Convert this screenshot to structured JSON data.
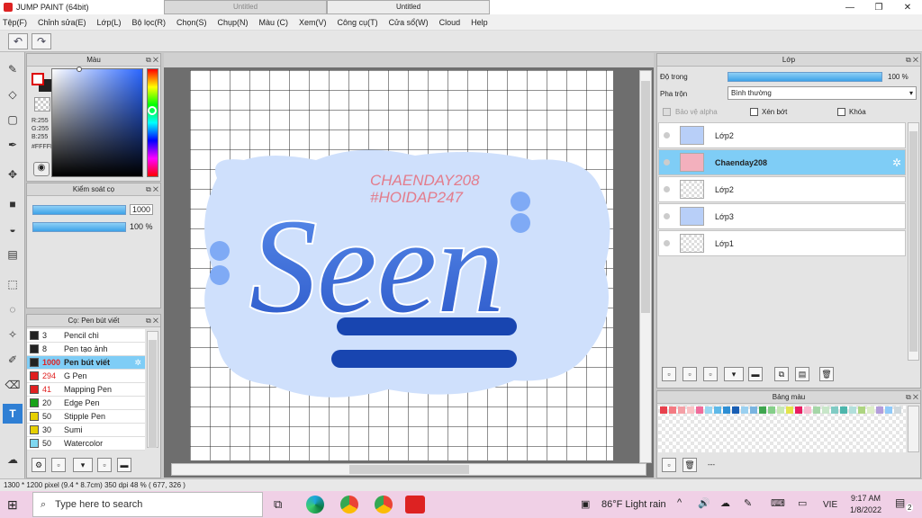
{
  "app": {
    "title": "JUMP PAINT (64bit)",
    "window_controls": [
      "—",
      "❐",
      "✕"
    ]
  },
  "menu": [
    "Tệp(F)",
    "Chỉnh sửa(E)",
    "Lớp(L)",
    "Bộ lọc(R)",
    "Chọn(S)",
    "Chụp(N)",
    "Màu (C)",
    "Xem(V)",
    "Công cụ(T)",
    "Cửa sổ(W)",
    "Cloud",
    "Help"
  ],
  "toolbar": {
    "undo": "↶",
    "redo": "↷"
  },
  "tools": [
    "brush-icon",
    "eraser-icon",
    "select-rect-icon",
    "pen-tool-icon",
    "move-icon",
    "fill-rect-icon",
    "bucket-icon",
    "gradient-icon",
    "lasso-icon",
    "ellipse-select-icon",
    "magic-wand-icon",
    "select-pen-icon",
    "select-eraser-icon",
    "text-tool-icon",
    "hand-icon"
  ],
  "color_panel": {
    "title": "Màu",
    "r": "R:255",
    "g": "G:255",
    "b": "B:255",
    "hex": "#FFFFFF"
  },
  "brush_panel": {
    "title": "Kiểm soát cọ",
    "size": "1000",
    "opacity": "100 %"
  },
  "pen_panel": {
    "title": "Cọ: Pen bút viết",
    "items": [
      {
        "num": "3",
        "name": "Pencil chì",
        "color": "#222222"
      },
      {
        "num": "8",
        "name": "Pen tạo ảnh",
        "color": "#222222"
      },
      {
        "num": "1000",
        "name": "Pen bút viết",
        "color": "#222222"
      },
      {
        "num": "294",
        "name": "G Pen",
        "color": "#e02020"
      },
      {
        "num": "41",
        "name": "Mapping Pen",
        "color": "#e02020"
      },
      {
        "num": "20",
        "name": "Edge Pen",
        "color": "#1aa31a"
      },
      {
        "num": "50",
        "name": "Stipple Pen",
        "color": "#e6d000"
      },
      {
        "num": "30",
        "name": "Sumi",
        "color": "#e6d000"
      },
      {
        "num": "50",
        "name": "Watercolor",
        "color": "#7fd8f0"
      }
    ]
  },
  "tabs": [
    "Untitled",
    "Untitled"
  ],
  "artwork": {
    "watermark1": "CHAENDAY208",
    "watermark2": "#HOIDAP247",
    "word": "Seen"
  },
  "layer_panel": {
    "title": "Lớp",
    "opacity_label": "Độ trong",
    "opacity_value": "100 %",
    "blend_label": "Pha trộn",
    "blend_value": "Bình thường",
    "protect_alpha": "Bảo vệ alpha",
    "clip": "Xén bớt",
    "lock": "Khóa",
    "layers": [
      {
        "name": "Lớp2",
        "selected": false
      },
      {
        "name": "Chaenday208",
        "selected": true
      },
      {
        "name": "Lớp2",
        "selected": false
      },
      {
        "name": "Lớp3",
        "selected": false
      },
      {
        "name": "Lớp1",
        "selected": false
      }
    ]
  },
  "palette_panel": {
    "title": "Bảng màu",
    "dash": "---",
    "colors": [
      "#e8414d",
      "#f37a82",
      "#f4a0a6",
      "#f9c2c5",
      "#f06c9b",
      "#99d6f1",
      "#5fb9e8",
      "#2f8fd4",
      "#1a5fb4",
      "#9ad0f0",
      "#7ab4e0",
      "#3fa64f",
      "#86cf8a",
      "#c7e7b5",
      "#e4e44c",
      "#e91e63",
      "#f8bbd0",
      "#a5d6a7",
      "#c8e6c9",
      "#80cbc4",
      "#4db6ac",
      "#b2dfdb",
      "#aed581",
      "#dcedc8",
      "#b39ddb",
      "#90caf9",
      "#cfd8dc"
    ]
  },
  "status": "1300 * 1200 pixel  (9.4 * 8.7cm)  350 dpi   48 %   ( 677, 326 )",
  "taskbar": {
    "search": "Type here to search",
    "weather": "86°F  Light rain",
    "lang": "VIE",
    "time": "9:17 AM",
    "date": "1/8/2022",
    "notif": "2"
  }
}
